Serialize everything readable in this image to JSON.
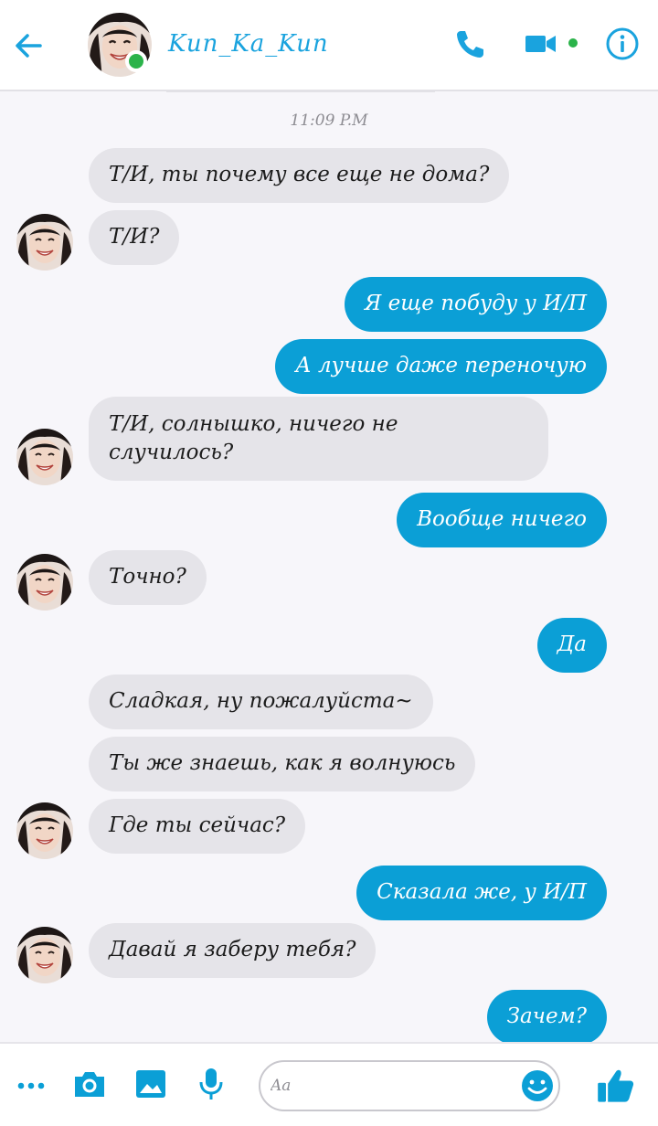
{
  "header": {
    "contact_name": "Kun_Ka_Kun"
  },
  "chat": {
    "timestamp": "11:09 P.M",
    "messages": [
      {
        "dir": "in",
        "text": "Т/И, ты почему все еще не дома?"
      },
      {
        "dir": "in",
        "text": "Т/И?"
      },
      {
        "dir": "out",
        "text": "Я еще побуду у И/П"
      },
      {
        "dir": "out",
        "text": "А лучше даже переночую"
      },
      {
        "dir": "in",
        "text": "Т/И, солнышко, ничего не случилось?"
      },
      {
        "dir": "out",
        "text": "Вообще ничего"
      },
      {
        "dir": "in",
        "text": "Точно?"
      },
      {
        "dir": "out",
        "text": "Да"
      },
      {
        "dir": "in",
        "text": "Сладкая, ну пожалуйста~"
      },
      {
        "dir": "in",
        "text": "Ты же знаешь, как я волнуюсь"
      },
      {
        "dir": "in",
        "text": "Где ты сейчас?"
      },
      {
        "dir": "out",
        "text": "Сказала же, у И/П"
      },
      {
        "dir": "in",
        "text": "Давай я заберу тебя?"
      },
      {
        "dir": "out",
        "text": "Зачем?"
      }
    ]
  },
  "composer": {
    "placeholder": "Aa"
  },
  "colors": {
    "accent": "#0b9fd6",
    "incoming_bubble": "#e5e4e9",
    "online": "#2bb34a",
    "background": "#f7f6fa"
  },
  "icons": {
    "back": "arrow-left-icon",
    "call": "phone-icon",
    "video": "video-camera-icon",
    "info": "info-icon",
    "more": "more-dots-icon",
    "camera": "camera-icon",
    "gallery": "image-icon",
    "voice": "microphone-icon",
    "emoji": "smiley-icon",
    "like": "thumbs-up-icon"
  }
}
